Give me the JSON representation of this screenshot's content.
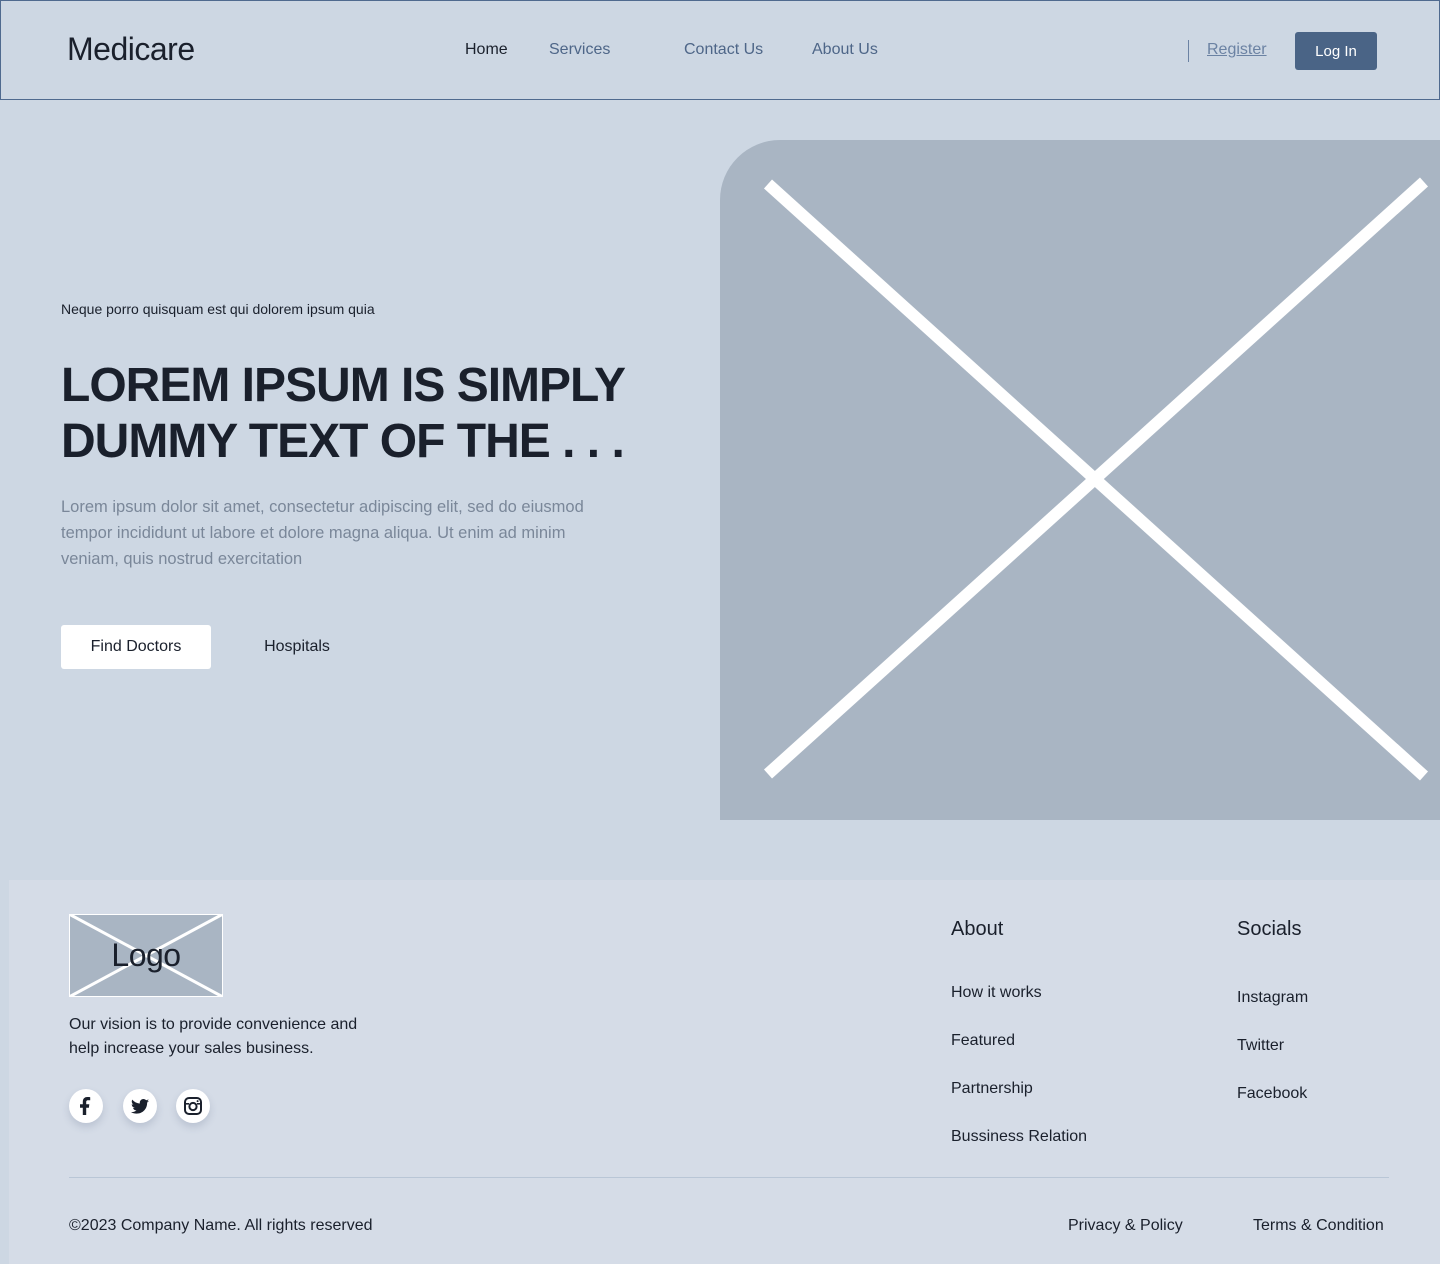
{
  "header": {
    "brand": "Medicare",
    "nav": [
      {
        "label": "Home",
        "active": true
      },
      {
        "label": "Services",
        "active": false
      },
      {
        "label": "Contact Us",
        "active": false
      },
      {
        "label": "About Us",
        "active": false
      }
    ],
    "register_label": "Register",
    "login_label": "Log In"
  },
  "hero": {
    "eyebrow": "Neque porro quisquam est qui dolorem ipsum quia",
    "title": "LOREM IPSUM IS SIMPLY DUMMY TEXT OF THE . . .",
    "description": "Lorem ipsum dolor sit amet, consectetur adipiscing elit, sed do eiusmod tempor incididunt ut labore et dolore magna aliqua. Ut enim ad minim veniam, quis nostrud exercitation",
    "primary_button": "Find Doctors",
    "secondary_button": "Hospitals"
  },
  "footer": {
    "logo_text": "Logo",
    "vision": "Our vision is to provide convenience and help increase your sales business.",
    "social_icons": [
      "facebook-icon",
      "twitter-icon",
      "instagram-icon"
    ],
    "about": {
      "title": "About",
      "links": [
        "How it works",
        "Featured",
        "Partnership",
        "Bussiness Relation"
      ]
    },
    "socials": {
      "title": "Socials",
      "links": [
        "Instagram",
        "Twitter",
        "Facebook"
      ]
    },
    "copyright": "©2023  Company Name. All rights reserved",
    "privacy": "Privacy & Policy",
    "terms": "Terms & Condition"
  },
  "colors": {
    "page_bg": "#cdd7e3",
    "footer_bg": "#d5dce7",
    "placeholder": "#a9b5c3",
    "accent": "#4a6486",
    "nav_text": "#4e6688",
    "text": "#1a202c"
  }
}
